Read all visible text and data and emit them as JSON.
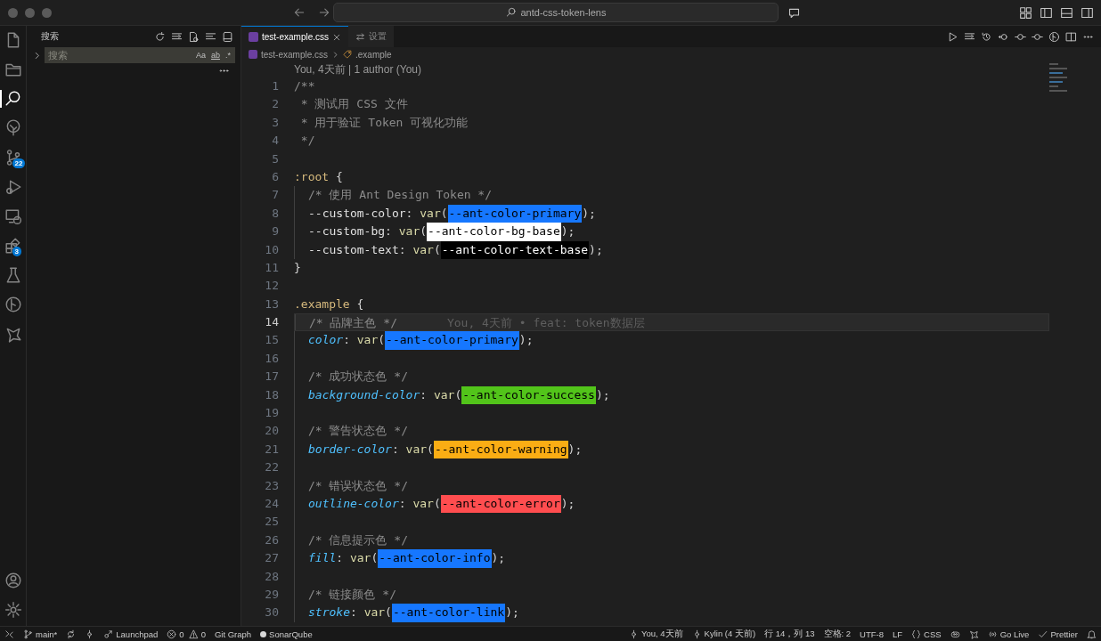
{
  "window": {
    "title": "antd-css-token-lens"
  },
  "activity_bar": {
    "items": [
      {
        "selected": false
      },
      {
        "selected": false
      },
      {
        "selected": true
      },
      {
        "selected": false
      },
      {
        "selected": false,
        "badge": "22"
      },
      {
        "selected": false
      },
      {
        "selected": false
      },
      {
        "selected": false,
        "badge": "3"
      },
      {
        "selected": false
      },
      {
        "selected": false
      },
      {
        "selected": false
      }
    ]
  },
  "sidebar": {
    "title": "搜索",
    "search": {
      "placeholder": "搜索",
      "options": [
        "Aa",
        "ab",
        ".*"
      ]
    }
  },
  "tabs": [
    {
      "label": "test-example.css",
      "selected": true,
      "kind": "file"
    },
    {
      "label": "设置",
      "selected": false,
      "kind": "settings"
    }
  ],
  "breadcrumb": [
    {
      "label": "test-example.css",
      "kind": "file"
    },
    {
      "label": ".example",
      "kind": "symbol"
    }
  ],
  "editor": {
    "codelens": "You, 4天前 | 1 author (You)",
    "lines": [
      {
        "number": "1",
        "selected": false,
        "indented": false,
        "tokens": [
          {
            "kind": "comment",
            "text": "/**"
          }
        ]
      },
      {
        "number": "2",
        "selected": false,
        "indented": false,
        "tokens": [
          {
            "kind": "comment",
            "text": " * 测试用 CSS 文件"
          }
        ]
      },
      {
        "number": "3",
        "selected": false,
        "indented": false,
        "tokens": [
          {
            "kind": "comment",
            "text": " * 用于验证 Token 可视化功能"
          }
        ]
      },
      {
        "number": "4",
        "selected": false,
        "indented": false,
        "tokens": [
          {
            "kind": "comment",
            "text": " */"
          }
        ]
      },
      {
        "number": "5",
        "selected": false,
        "indented": false
      },
      {
        "number": "6",
        "selected": false,
        "indented": false,
        "tokens": [
          {
            "kind": "selector",
            "text": ":root"
          },
          {
            "kind": "punct",
            "text": " {"
          }
        ]
      },
      {
        "number": "7",
        "selected": false,
        "indented": true,
        "tokens": [
          {
            "kind": "comment",
            "text": "/* 使用 Ant Design Token */"
          }
        ]
      },
      {
        "number": "8",
        "selected": false,
        "indented": true,
        "tokens": [
          {
            "kind": "variable",
            "text": "--custom-color"
          },
          {
            "kind": "punct",
            "text": ": "
          },
          {
            "kind": "function",
            "text": "var"
          },
          {
            "kind": "punct",
            "text": "("
          },
          {
            "kind": "token",
            "text": "--ant-color-primary",
            "color": "#1677ff"
          },
          {
            "kind": "punct",
            "text": ");"
          }
        ]
      },
      {
        "number": "9",
        "selected": false,
        "indented": true,
        "tokens": [
          {
            "kind": "variable",
            "text": "--custom-bg"
          },
          {
            "kind": "punct",
            "text": ": "
          },
          {
            "kind": "function",
            "text": "var"
          },
          {
            "kind": "punct",
            "text": "("
          },
          {
            "kind": "token",
            "text": "--ant-color-bg-base",
            "color": "#ffffff"
          },
          {
            "kind": "punct",
            "text": ");"
          }
        ]
      },
      {
        "number": "10",
        "selected": false,
        "indented": true,
        "tokens": [
          {
            "kind": "variable",
            "text": "--custom-text"
          },
          {
            "kind": "punct",
            "text": ": "
          },
          {
            "kind": "function",
            "text": "var"
          },
          {
            "kind": "punct",
            "text": "("
          },
          {
            "kind": "token",
            "text": "--ant-color-text-base",
            "color": "#000000"
          },
          {
            "kind": "punct",
            "text": ");"
          }
        ]
      },
      {
        "number": "11",
        "selected": false,
        "indented": false,
        "tokens": [
          {
            "kind": "punct",
            "text": "}"
          }
        ]
      },
      {
        "number": "12",
        "selected": false,
        "indented": false
      },
      {
        "number": "13",
        "selected": false,
        "indented": false,
        "tokens": [
          {
            "kind": "selector",
            "text": ".example"
          },
          {
            "kind": "punct",
            "text": " {"
          }
        ]
      },
      {
        "number": "14",
        "selected": true,
        "indented": true,
        "tokens": [
          {
            "kind": "comment",
            "text": "/* 品牌主色 */"
          }
        ],
        "blame": "You, 4天前 • feat: token数据层"
      },
      {
        "number": "15",
        "selected": false,
        "indented": true,
        "tokens": [
          {
            "kind": "property",
            "text": "color"
          },
          {
            "kind": "punct",
            "text": ": "
          },
          {
            "kind": "function",
            "text": "var"
          },
          {
            "kind": "punct",
            "text": "("
          },
          {
            "kind": "token",
            "text": "--ant-color-primary",
            "color": "#1677ff"
          },
          {
            "kind": "punct",
            "text": ");"
          }
        ]
      },
      {
        "number": "16",
        "selected": false,
        "indented": true
      },
      {
        "number": "17",
        "selected": false,
        "indented": true,
        "tokens": [
          {
            "kind": "comment",
            "text": "/* 成功状态色 */"
          }
        ]
      },
      {
        "number": "18",
        "selected": false,
        "indented": true,
        "tokens": [
          {
            "kind": "property",
            "text": "background-color"
          },
          {
            "kind": "punct",
            "text": ": "
          },
          {
            "kind": "function",
            "text": "var"
          },
          {
            "kind": "punct",
            "text": "("
          },
          {
            "kind": "token",
            "text": "--ant-color-success",
            "color": "#52c41a"
          },
          {
            "kind": "punct",
            "text": ");"
          }
        ]
      },
      {
        "number": "19",
        "selected": false,
        "indented": true
      },
      {
        "number": "20",
        "selected": false,
        "indented": true,
        "tokens": [
          {
            "kind": "comment",
            "text": "/* 警告状态色 */"
          }
        ]
      },
      {
        "number": "21",
        "selected": false,
        "indented": true,
        "tokens": [
          {
            "kind": "property",
            "text": "border-color"
          },
          {
            "kind": "punct",
            "text": ": "
          },
          {
            "kind": "function",
            "text": "var"
          },
          {
            "kind": "punct",
            "text": "("
          },
          {
            "kind": "token",
            "text": "--ant-color-warning",
            "color": "#faad14"
          },
          {
            "kind": "punct",
            "text": ");"
          }
        ]
      },
      {
        "number": "22",
        "selected": false,
        "indented": true
      },
      {
        "number": "23",
        "selected": false,
        "indented": true,
        "tokens": [
          {
            "kind": "comment",
            "text": "/* 错误状态色 */"
          }
        ]
      },
      {
        "number": "24",
        "selected": false,
        "indented": true,
        "tokens": [
          {
            "kind": "property",
            "text": "outline-color"
          },
          {
            "kind": "punct",
            "text": ": "
          },
          {
            "kind": "function",
            "text": "var"
          },
          {
            "kind": "punct",
            "text": "("
          },
          {
            "kind": "token",
            "text": "--ant-color-error",
            "color": "#ff4d4f"
          },
          {
            "kind": "punct",
            "text": ");"
          }
        ]
      },
      {
        "number": "25",
        "selected": false,
        "indented": true
      },
      {
        "number": "26",
        "selected": false,
        "indented": true,
        "tokens": [
          {
            "kind": "comment",
            "text": "/* 信息提示色 */"
          }
        ]
      },
      {
        "number": "27",
        "selected": false,
        "indented": true,
        "tokens": [
          {
            "kind": "property",
            "text": "fill"
          },
          {
            "kind": "punct",
            "text": ": "
          },
          {
            "kind": "function",
            "text": "var"
          },
          {
            "kind": "punct",
            "text": "("
          },
          {
            "kind": "token",
            "text": "--ant-color-info",
            "color": "#1677ff"
          },
          {
            "kind": "punct",
            "text": ");"
          }
        ]
      },
      {
        "number": "28",
        "selected": false,
        "indented": true
      },
      {
        "number": "29",
        "selected": false,
        "indented": true,
        "tokens": [
          {
            "kind": "comment",
            "text": "/* 链接颜色 */"
          }
        ]
      },
      {
        "number": "30",
        "selected": false,
        "indented": true,
        "tokens": [
          {
            "kind": "property",
            "text": "stroke"
          },
          {
            "kind": "punct",
            "text": ": "
          },
          {
            "kind": "function",
            "text": "var"
          },
          {
            "kind": "punct",
            "text": "("
          },
          {
            "kind": "token",
            "text": "--ant-color-link",
            "color": "#1677ff"
          },
          {
            "kind": "punct",
            "text": ");"
          }
        ]
      }
    ]
  },
  "status_bar": {
    "left": [
      {
        "kind": "remote"
      },
      {
        "kind": "branch",
        "text": "main*"
      },
      {
        "kind": "sync"
      },
      {
        "kind": "graph"
      },
      {
        "kind": "launchpad",
        "text": "Launchpad"
      },
      {
        "kind": "errors",
        "text": "0"
      },
      {
        "kind": "warnings",
        "text": "0"
      },
      {
        "kind": "text",
        "text": "Git Graph"
      },
      {
        "kind": "dot",
        "text": "SonarQube"
      }
    ],
    "right": [
      {
        "kind": "blame",
        "text": "You, 4天前"
      },
      {
        "kind": "blame",
        "text": "Kylin (4 天前)"
      },
      {
        "kind": "text",
        "text": "行 14，列 13"
      },
      {
        "kind": "text",
        "text": "空格: 2"
      },
      {
        "kind": "text",
        "text": "UTF-8"
      },
      {
        "kind": "text",
        "text": "LF"
      },
      {
        "kind": "language",
        "text": "CSS"
      },
      {
        "kind": "copilot"
      },
      {
        "kind": "extension"
      },
      {
        "kind": "live",
        "text": "Go Live"
      },
      {
        "kind": "prettier",
        "text": "Prettier"
      },
      {
        "kind": "bell"
      }
    ]
  }
}
